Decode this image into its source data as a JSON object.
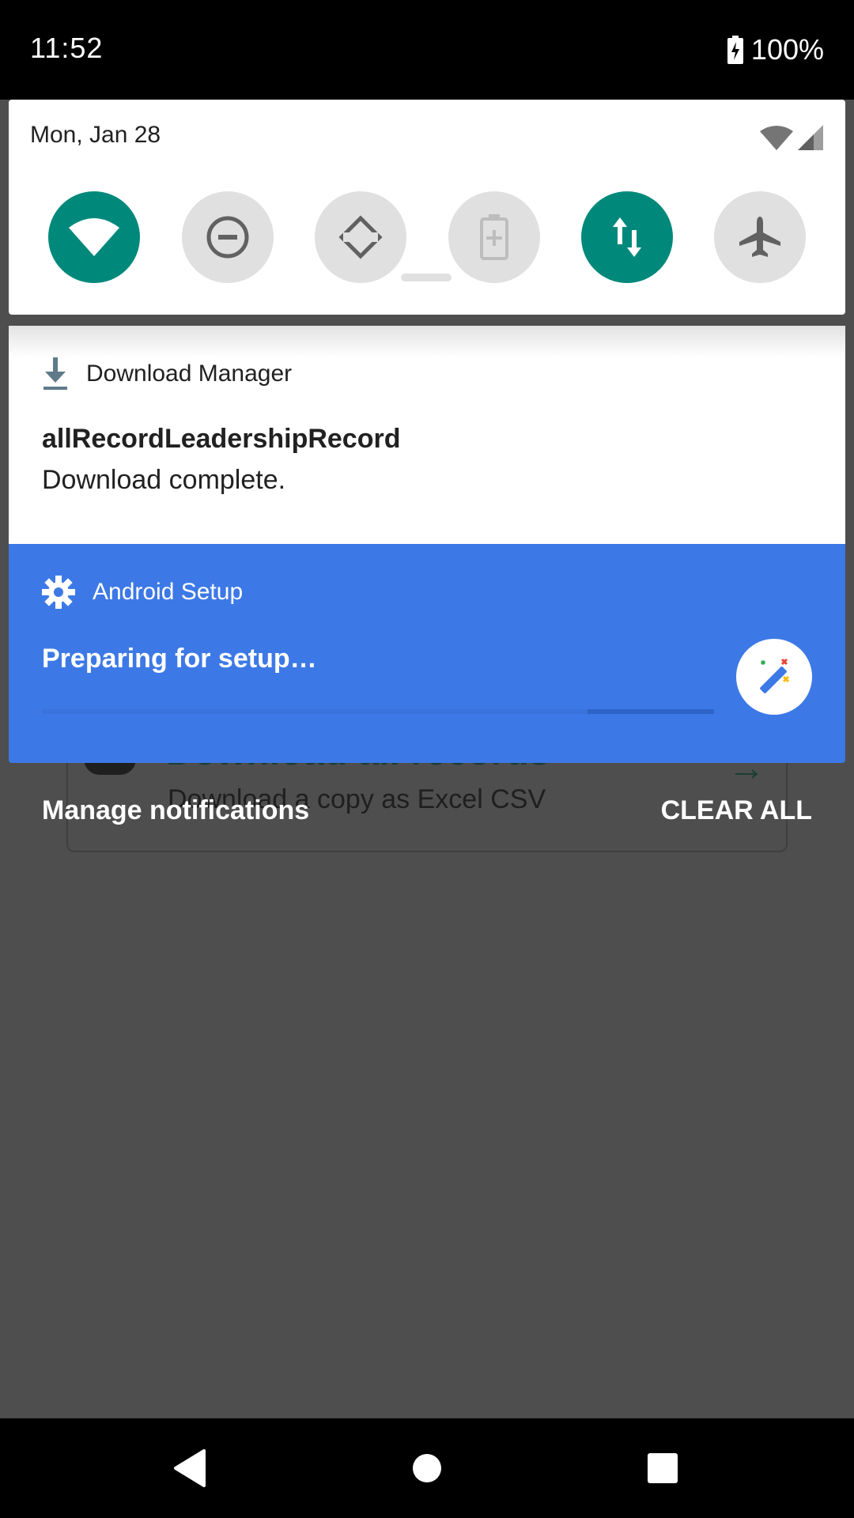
{
  "status_bar": {
    "time": "11:52",
    "battery": "100%"
  },
  "quick_settings": {
    "date": "Mon, Jan 28",
    "tiles": [
      {
        "name": "wifi",
        "icon": "wifi-icon",
        "state": "on"
      },
      {
        "name": "do-not-disturb",
        "icon": "dnd-icon",
        "state": "off"
      },
      {
        "name": "auto-rotate",
        "icon": "rotate-icon",
        "state": "off"
      },
      {
        "name": "battery-saver",
        "icon": "battery-saver-icon",
        "state": "off"
      },
      {
        "name": "mobile-data",
        "icon": "data-arrows-icon",
        "state": "on"
      },
      {
        "name": "airplane-mode",
        "icon": "airplane-icon",
        "state": "off"
      }
    ],
    "accent_color": "#00897b"
  },
  "background_app": {
    "card_title": "Download all records",
    "card_subtitle": "Download a copy as Excel CSV"
  },
  "notifications": {
    "download": {
      "app_name": "Download Manager",
      "title": "allRecordLeadershipRecord",
      "text": "Download complete."
    },
    "setup": {
      "app_name": "Android Setup",
      "title": "Preparing for setup…",
      "background_color": "#3d79e6"
    }
  },
  "actions": {
    "manage": "Manage notifications",
    "clear_all": "CLEAR ALL"
  }
}
